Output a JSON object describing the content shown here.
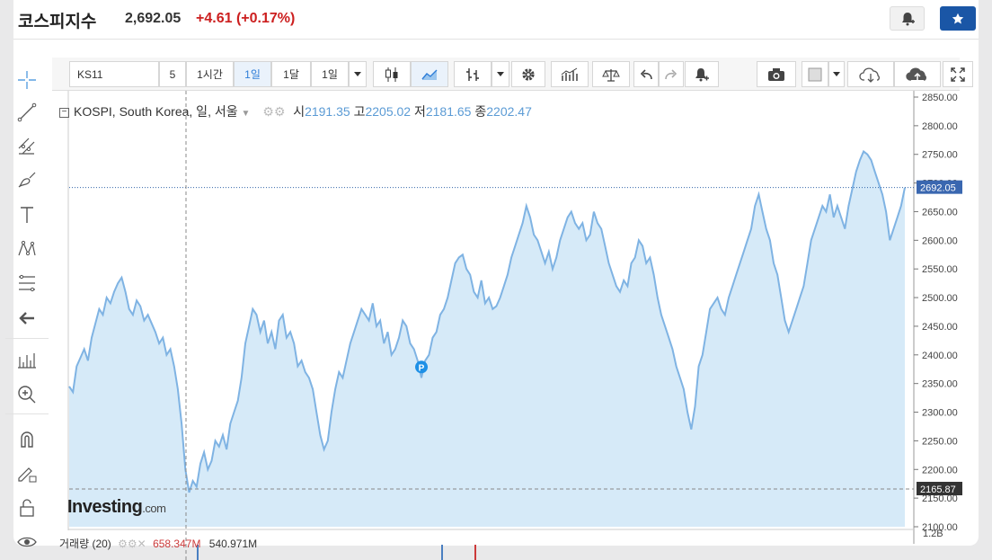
{
  "header": {
    "title": "코스피지수",
    "price": "2,692.05",
    "change": "+4.61",
    "change_pct": "(+0.17%)"
  },
  "toolbar": {
    "symbol": "KS11",
    "interval_5": "5",
    "interval_1h": "1시간",
    "interval_1d": "1일",
    "interval_1mo": "1달",
    "range": "1일"
  },
  "legend": {
    "name": "KOSPI, South Korea, 일, 서울",
    "open_label": "시",
    "open": "2191.35",
    "high_label": "고",
    "high": "2205.02",
    "low_label": "저",
    "low": "2181.65",
    "close_label": "종",
    "close": "2202.47"
  },
  "watermark": {
    "brand": "Investing",
    "suffix": ".com"
  },
  "volume": {
    "label": "거래량 (20)",
    "v1": "658.347M",
    "v2": "540.971M",
    "axis_label": "1.2B"
  },
  "colors": {
    "line": "#7fb3e3",
    "fill": "#d6eaf8",
    "up": "#cc1f1f",
    "star_btn": "#1a56a6"
  },
  "chart_data": {
    "type": "area",
    "title": "KOSPI, South Korea, 일, 서울",
    "ylim": [
      2100,
      2850
    ],
    "y_ticks": [
      "2850.00",
      "2800.00",
      "2750.00",
      "2700.00",
      "2650.00",
      "2600.00",
      "2550.00",
      "2500.00",
      "2450.00",
      "2400.00",
      "2350.00",
      "2300.00",
      "2250.00",
      "2200.00",
      "2150.00",
      "2100.00"
    ],
    "current_price_label": "2692.05",
    "crosshair_price_label": "2165.87",
    "series": [
      {
        "values": [
          2345,
          2335,
          2380,
          2395,
          2410,
          2390,
          2430,
          2455,
          2480,
          2470,
          2500,
          2490,
          2510,
          2525,
          2535,
          2510,
          2480,
          2470,
          2495,
          2485,
          2460,
          2470,
          2455,
          2440,
          2420,
          2430,
          2400,
          2410,
          2380,
          2340,
          2280,
          2200,
          2160,
          2180,
          2170,
          2210,
          2230,
          2200,
          2215,
          2250,
          2240,
          2260,
          2235,
          2280,
          2300,
          2320,
          2360,
          2420,
          2450,
          2480,
          2470,
          2440,
          2460,
          2420,
          2440,
          2410,
          2460,
          2470,
          2430,
          2440,
          2420,
          2380,
          2390,
          2370,
          2360,
          2340,
          2300,
          2260,
          2235,
          2250,
          2300,
          2340,
          2370,
          2360,
          2390,
          2420,
          2440,
          2460,
          2480,
          2470,
          2460,
          2490,
          2450,
          2460,
          2420,
          2440,
          2400,
          2410,
          2430,
          2460,
          2450,
          2420,
          2410,
          2390,
          2360,
          2390,
          2400,
          2430,
          2440,
          2470,
          2480,
          2500,
          2530,
          2560,
          2570,
          2575,
          2550,
          2540,
          2510,
          2500,
          2530,
          2490,
          2500,
          2480,
          2485,
          2500,
          2520,
          2540,
          2570,
          2590,
          2610,
          2630,
          2660,
          2640,
          2610,
          2600,
          2580,
          2560,
          2580,
          2550,
          2570,
          2600,
          2620,
          2640,
          2650,
          2630,
          2620,
          2630,
          2600,
          2610,
          2650,
          2630,
          2620,
          2590,
          2560,
          2540,
          2520,
          2510,
          2530,
          2520,
          2560,
          2570,
          2600,
          2590,
          2560,
          2570,
          2540,
          2500,
          2470,
          2450,
          2430,
          2410,
          2380,
          2360,
          2340,
          2300,
          2270,
          2310,
          2380,
          2400,
          2440,
          2480,
          2490,
          2500,
          2480,
          2470,
          2500,
          2520,
          2540,
          2560,
          2580,
          2600,
          2620,
          2660,
          2680,
          2650,
          2620,
          2600,
          2560,
          2540,
          2500,
          2460,
          2440,
          2460,
          2480,
          2500,
          2520,
          2560,
          2600,
          2620,
          2640,
          2660,
          2650,
          2680,
          2640,
          2660,
          2640,
          2620,
          2660,
          2690,
          2720,
          2740,
          2755,
          2750,
          2740,
          2720,
          2700,
          2680,
          2650,
          2600,
          2620,
          2640,
          2660,
          2692.05
        ]
      }
    ]
  }
}
